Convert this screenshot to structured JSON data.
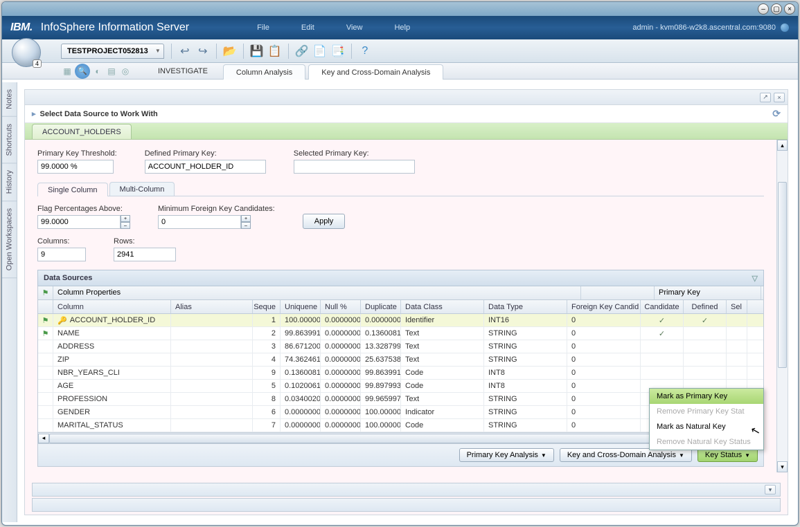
{
  "window": {
    "app_logo": "IBM.",
    "app_title": "InfoSphere Information Server"
  },
  "menubar": [
    "File",
    "Edit",
    "View",
    "Help"
  ],
  "user_info": "admin - kvm086-w2k8.ascentral.com:9080",
  "project_tab": "TESTPROJECT052813",
  "orb_badge": "4",
  "step_label": "INVESTIGATE",
  "subtabs": {
    "a": "Column Analysis",
    "b": "Key and Cross-Domain Analysis"
  },
  "side_tabs": [
    "Notes",
    "Shortcuts",
    "History",
    "Open Workspaces"
  ],
  "source_title": "Select Data Source to Work With",
  "table_tab": "ACCOUNT_HOLDERS",
  "labels": {
    "pk_threshold": "Primary Key Threshold:",
    "defined_pk": "Defined Primary Key:",
    "selected_pk": "Selected Primary Key:",
    "flag_pct": "Flag Percentages Above:",
    "min_fk": "Minimum Foreign Key Candidates:",
    "apply": "Apply",
    "columns": "Columns:",
    "rows": "Rows:",
    "ds_header": "Data Sources",
    "col_props": "Column Properties",
    "pk_group": "Primary Key"
  },
  "values": {
    "pk_threshold": "99.0000 %",
    "defined_pk": "ACCOUNT_HOLDER_ID",
    "selected_pk": "",
    "flag_pct": "99.0000",
    "min_fk": "0",
    "columns": "9",
    "rows": "2941"
  },
  "inner_tabs": {
    "single": "Single Column",
    "multi": "Multi-Column"
  },
  "headers": {
    "column": "Column",
    "alias": "Alias",
    "seq": "Seque",
    "uniq": "Uniquene",
    "null": "Null %",
    "dup": "Duplicate",
    "class": "Data Class",
    "dtype": "Data Type",
    "fk": "Foreign Key Candid",
    "cand": "Candidate",
    "def": "Defined",
    "sel": "Sel"
  },
  "rows_data": [
    {
      "flag": true,
      "column": "ACCOUNT_HOLDER_ID",
      "seq": "1",
      "uniq": "100.00000",
      "null": "0.0000000",
      "dup": "0.0000000",
      "class": "Identifier",
      "dtype": "INT16",
      "fk": "0",
      "cand": true,
      "def": true
    },
    {
      "flag": true,
      "column": "NAME",
      "seq": "2",
      "uniq": "99.863991",
      "null": "0.0000000",
      "dup": "0.1360081",
      "class": "Text",
      "dtype": "STRING",
      "fk": "0",
      "cand": true,
      "def": false
    },
    {
      "flag": false,
      "column": "ADDRESS",
      "seq": "3",
      "uniq": "86.671200",
      "null": "0.0000000",
      "dup": "13.328799",
      "class": "Text",
      "dtype": "STRING",
      "fk": "0",
      "cand": false,
      "def": false
    },
    {
      "flag": false,
      "column": "ZIP",
      "seq": "4",
      "uniq": "74.362461",
      "null": "0.0000000",
      "dup": "25.637538",
      "class": "Text",
      "dtype": "STRING",
      "fk": "0",
      "cand": false,
      "def": false
    },
    {
      "flag": false,
      "column": "NBR_YEARS_CLI",
      "seq": "9",
      "uniq": "0.1360081",
      "null": "0.0000000",
      "dup": "99.863991",
      "class": "Code",
      "dtype": "INT8",
      "fk": "0",
      "cand": false,
      "def": false
    },
    {
      "flag": false,
      "column": "AGE",
      "seq": "5",
      "uniq": "0.1020061",
      "null": "0.0000000",
      "dup": "99.897993",
      "class": "Code",
      "dtype": "INT8",
      "fk": "0",
      "cand": false,
      "def": false
    },
    {
      "flag": false,
      "column": "PROFESSION",
      "seq": "8",
      "uniq": "0.0340020",
      "null": "0.0000000",
      "dup": "99.965997",
      "class": "Text",
      "dtype": "STRING",
      "fk": "0",
      "cand": false,
      "def": false
    },
    {
      "flag": false,
      "column": "GENDER",
      "seq": "6",
      "uniq": "0.0000000",
      "null": "0.0000000",
      "dup": "100.00000",
      "class": "Indicator",
      "dtype": "STRING",
      "fk": "0",
      "cand": false,
      "def": false
    },
    {
      "flag": false,
      "column": "MARITAL_STATUS",
      "seq": "7",
      "uniq": "0.0000000",
      "null": "0.0000000",
      "dup": "100.00000",
      "class": "Code",
      "dtype": "STRING",
      "fk": "0",
      "cand": false,
      "def": false
    }
  ],
  "action_buttons": {
    "pka": "Primary Key Analysis",
    "kcda": "Key and Cross-Domain Analysis",
    "ks": "Key Status"
  },
  "menu_items": {
    "mark_pk": "Mark as Primary Key",
    "remove_pk": "Remove Primary Key Stat",
    "mark_nk": "Mark as Natural Key",
    "remove_nk": "Remove Natural Key Status"
  }
}
